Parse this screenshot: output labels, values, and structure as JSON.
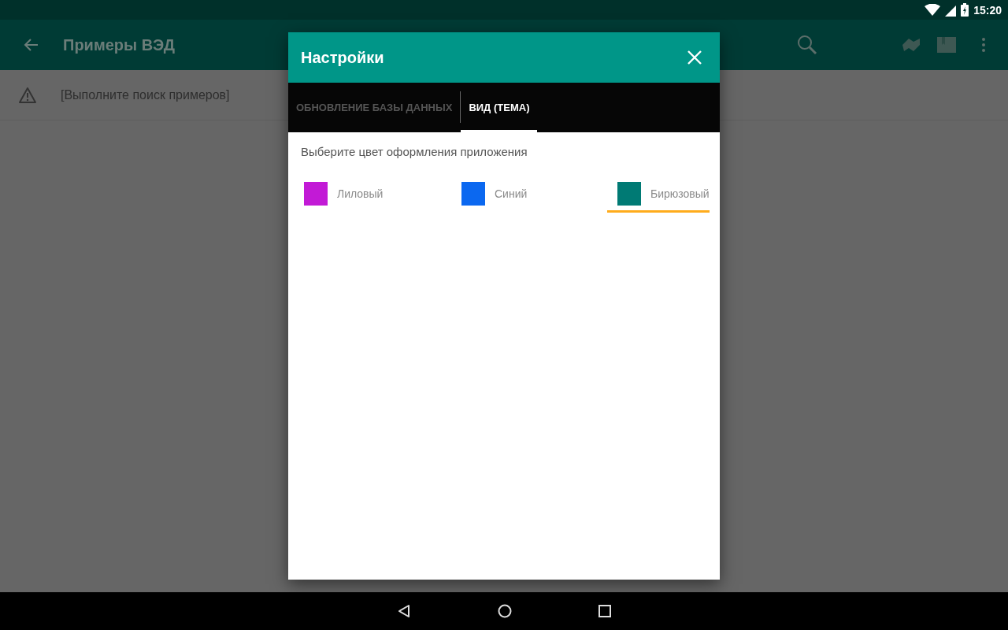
{
  "status_bar": {
    "time": "15:20"
  },
  "app_bar": {
    "title": "Примеры ВЭД"
  },
  "content": {
    "message": "[Выполните поиск примеров]"
  },
  "dialog": {
    "title": "Настройки",
    "tabs": [
      {
        "label": "ОБНОВЛЕНИЕ БАЗЫ ДАННЫХ",
        "selected": false
      },
      {
        "label": "ВИД (ТЕМА)",
        "selected": true
      }
    ],
    "prompt": "Выберите цвет оформления приложения",
    "themes": [
      {
        "label": "Лиловый",
        "color": "#c21ad6",
        "selected": false
      },
      {
        "label": "Синий",
        "color": "#0b68f0",
        "selected": false
      },
      {
        "label": "Бирюзовый",
        "color": "#007a74",
        "selected": true
      }
    ]
  }
}
